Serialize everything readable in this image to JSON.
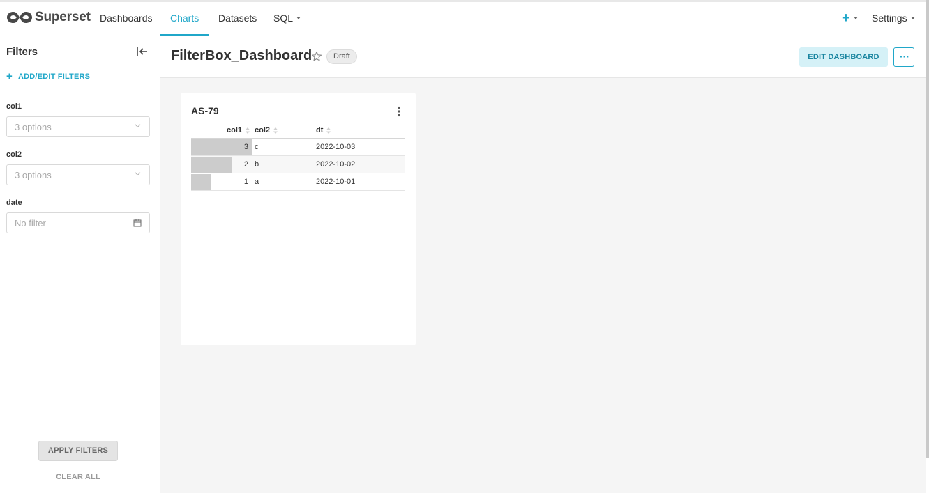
{
  "app": {
    "brand": "Superset",
    "nav": {
      "dashboards": "Dashboards",
      "charts": "Charts",
      "datasets": "Datasets",
      "sql": "SQL"
    },
    "right": {
      "plus": "+",
      "settings": "Settings"
    },
    "accent_color": "#20a7c9"
  },
  "sidebar": {
    "title": "Filters",
    "add_filters": "ADD/EDIT FILTERS",
    "filters": [
      {
        "label": "col1",
        "placeholder": "3 options"
      },
      {
        "label": "col2",
        "placeholder": "3 options"
      },
      {
        "label": "date",
        "placeholder": "No filter"
      }
    ],
    "apply": "APPLY FILTERS",
    "clear": "CLEAR ALL"
  },
  "header": {
    "title": "FilterBox_Dashboard",
    "badge": "Draft",
    "edit": "EDIT DASHBOARD",
    "more": "···"
  },
  "chart": {
    "title": "AS-79",
    "columns": [
      "col1",
      "col2",
      "dt"
    ],
    "rows": [
      {
        "col1": "3",
        "col2": "c",
        "dt": "2022-10-03",
        "bar_fraction": 1.0
      },
      {
        "col1": "2",
        "col2": "b",
        "dt": "2022-10-02",
        "bar_fraction": 0.6667
      },
      {
        "col1": "1",
        "col2": "a",
        "dt": "2022-10-01",
        "bar_fraction": 0.3333
      }
    ]
  }
}
